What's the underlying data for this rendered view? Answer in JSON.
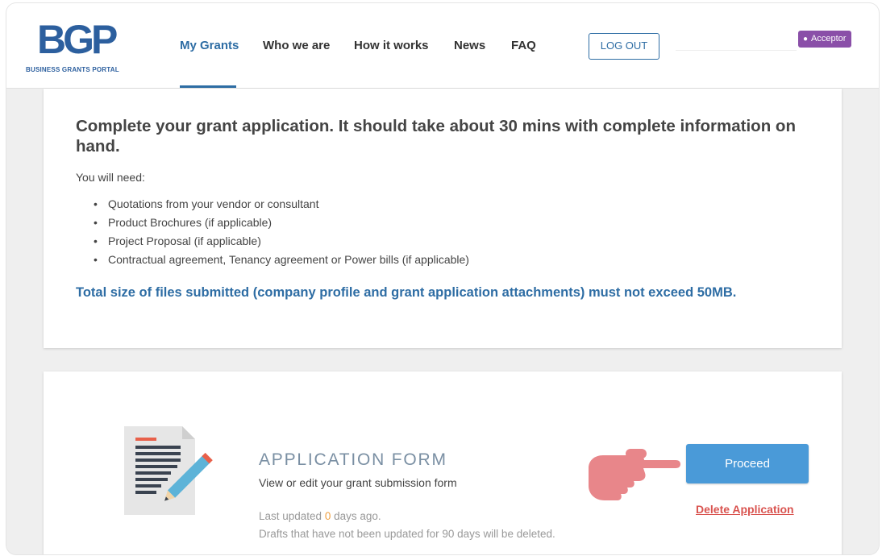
{
  "logo": {
    "text": "BGP",
    "subtitle": "BUSINESS GRANTS PORTAL"
  },
  "nav": {
    "items": [
      {
        "label": "My Grants",
        "active": true
      },
      {
        "label": "Who we are"
      },
      {
        "label": "How it works"
      },
      {
        "label": "News"
      },
      {
        "label": "FAQ"
      }
    ],
    "logout_label": "LOG OUT"
  },
  "user": {
    "role": "Acceptor",
    "role_icon": "user-icon"
  },
  "intro": {
    "heading": "Complete your grant application. It should take about 30 mins with complete information on hand.",
    "need_label": "You will need:",
    "needs": [
      "Quotations from your vendor or consultant",
      "Product Brochures (if applicable)",
      "Project Proposal (if applicable)",
      "Contractual agreement, Tenancy agreement or Power bills (if applicable)"
    ],
    "size_note": "Total size of files submitted (company profile and grant application attachments) must not exceed 50MB."
  },
  "form": {
    "title": "APPLICATION FORM",
    "subtitle": "View or edit your grant submission form",
    "last_updated_prefix": "Last updated ",
    "last_updated_days": "0",
    "last_updated_suffix": " days ago.",
    "drafts_note": "Drafts that have not been updated for 90 days will be deleted.",
    "proceed_label": "Proceed",
    "delete_label": "Delete Application"
  },
  "colors": {
    "brand": "#2c5f9e",
    "accent": "#2e6da4",
    "proceed_button": "#4a9ad8",
    "delete_link": "#d9534f",
    "role_badge": "#8a4fa8",
    "pointer_hand": "#e8868a"
  }
}
